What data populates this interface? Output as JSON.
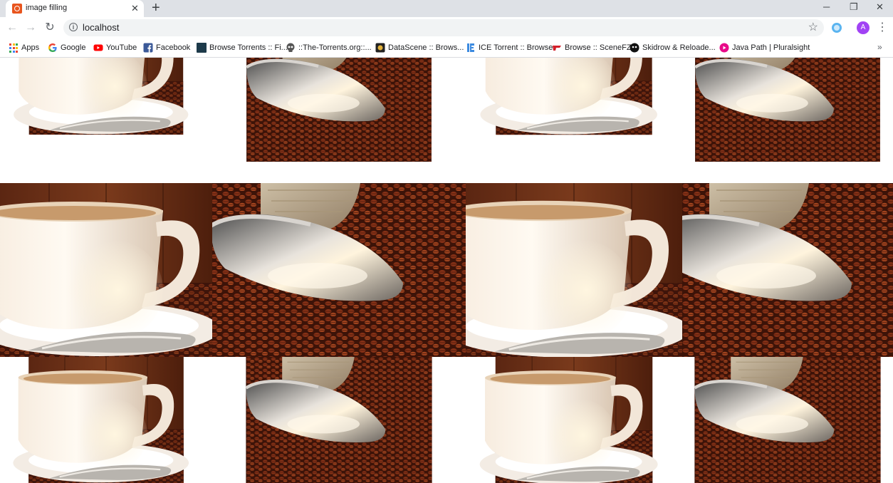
{
  "tab": {
    "title": "image filling",
    "close": "✕"
  },
  "new_tab": "+",
  "window": {
    "minimize": "─",
    "restore": "❐",
    "close": "✕"
  },
  "toolbar": {
    "back": "←",
    "forward": "→",
    "reload": "↻",
    "url": "localhost",
    "star": "☆",
    "avatar_letter": "A",
    "menu": "⋮"
  },
  "bookmarks": [
    {
      "label": "Apps"
    },
    {
      "label": "Google"
    },
    {
      "label": "YouTube"
    },
    {
      "label": "Facebook"
    },
    {
      "label": "Browse Torrents :: Fi..."
    },
    {
      "label": "::The-Torrents.org::..."
    },
    {
      "label": "DataScene :: Brows..."
    },
    {
      "label": "ICE Torrent :: Browse"
    },
    {
      "label": "Browse :: SceneFZ"
    },
    {
      "label": "Skidrow & Reloade..."
    },
    {
      "label": "Java Path | Pluralsight"
    }
  ],
  "bookmarks_more": "»",
  "colors": {
    "tabstrip": "#dee1e6",
    "omnibox": "#f1f3f4",
    "avatar": "#a142f4",
    "wood": "#6b2f16",
    "beans": "#5a1c0c"
  }
}
